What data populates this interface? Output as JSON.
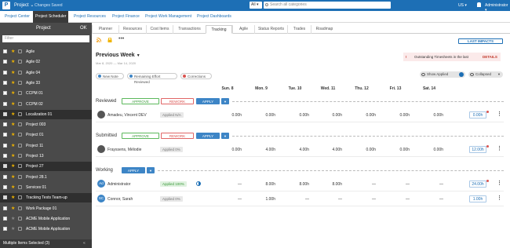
{
  "topbar": {
    "logo": "P",
    "project": "Project",
    "saved": "Changes Saved",
    "scope": "All",
    "search_placeholder": "Search all categories",
    "locale": "US",
    "user": "Administrator"
  },
  "nav": {
    "tabs": [
      "Project Center",
      "Project Scheduler",
      "Project Resources",
      "Project Finance",
      "Project Work Management",
      "Project Dashboards"
    ],
    "active": 1
  },
  "sidebar": {
    "title": "Project",
    "ok": "OK",
    "filter_placeholder": "Filter",
    "items": [
      {
        "label": "Agile",
        "star": true,
        "selected": false
      },
      {
        "label": "Agile 02",
        "star": true,
        "selected": false
      },
      {
        "label": "Agile 04",
        "star": true,
        "selected": false
      },
      {
        "label": "Agile 33",
        "star": true,
        "selected": false
      },
      {
        "label": "CCPM 01",
        "star": true,
        "selected": false
      },
      {
        "label": "CCPM 02",
        "star": true,
        "selected": false
      },
      {
        "label": "Localization 01",
        "star": true,
        "selected": true
      },
      {
        "label": "Project 003",
        "star": true,
        "selected": false
      },
      {
        "label": "Project 01",
        "star": true,
        "selected": false
      },
      {
        "label": "Project 11",
        "star": true,
        "selected": false
      },
      {
        "label": "Project 13",
        "star": true,
        "selected": false
      },
      {
        "label": "Project 27",
        "star": true,
        "selected": true
      },
      {
        "label": "Project 28.1",
        "star": true,
        "selected": false
      },
      {
        "label": "Services 01",
        "star": true,
        "selected": false
      },
      {
        "label": "Tracking Tests Team-up",
        "star": true,
        "selected": true
      },
      {
        "label": "Work Package 01",
        "star": true,
        "selected": false
      },
      {
        "label": "ACME Mobile Application",
        "star": false,
        "selected": false
      },
      {
        "label": "ACME Mobile Application",
        "star": false,
        "selected": false
      }
    ],
    "footer": "Multiple Items Selected (3)",
    "collapse": "«"
  },
  "subtabs": {
    "items": [
      "Planner",
      "Resources",
      "Cost Items",
      "Transactions",
      "Tracking",
      "Agile",
      "Status Reports",
      "Trades",
      "Roadmap"
    ],
    "active": 4
  },
  "toolbar": {
    "last_impacts": "LAST IMPACTS"
  },
  "period": {
    "title": "Previous Week",
    "range": "Mar 8, 2020 — Mar 14, 2020"
  },
  "warning": {
    "icon": "!",
    "text": "Outstanding Timesheets in the last",
    "link": "DETAILS"
  },
  "filters": {
    "new_note": "New Note",
    "remaining": "Remaining Effort Reviewed",
    "corrections": "Corrections",
    "show_applied": "Show Applied",
    "collapsed": "Collapsed"
  },
  "days": [
    "Sun. 8",
    "Mon. 9",
    "Tue. 10",
    "Wed. 11",
    "Thu. 12",
    "Fri. 13",
    "Sat. 14"
  ],
  "actions": {
    "approve": "APPROVE",
    "reword": "REWORK",
    "apply": "APPLY",
    "drop": "▼"
  },
  "sections": [
    {
      "title": "Reviewed",
      "rows": [
        {
          "initials": "",
          "name": "Amadeu, Vincent DEV",
          "status": "Applied",
          "pct": "N/A",
          "cells": [
            "0.00h",
            "0.00h",
            "0.00h",
            "0.00h",
            "0.00h",
            "0.00h",
            "0.00h"
          ],
          "total": "0.00h"
        }
      ]
    },
    {
      "title": "Submitted",
      "rows": [
        {
          "initials": "",
          "name": "Frayssens, Mélodie",
          "status": "Applied",
          "pct": "0%",
          "cells": [
            "0.00h",
            "4.00h",
            "4.00h",
            "4.00h",
            "0.00h",
            "0.00h",
            "0.00h"
          ],
          "total": "12.00h"
        }
      ]
    },
    {
      "title": "Working",
      "rows": [
        {
          "initials": "Ad",
          "name": "Administrator",
          "status": "Applied",
          "pct": "100%",
          "cells": [
            "—",
            "8.00h",
            "8.00h",
            "8.00h",
            "—",
            "—",
            "—"
          ],
          "total": "24.00h"
        },
        {
          "initials": "SC",
          "name": "Connor, Sarah",
          "status": "Applied",
          "pct": "0%",
          "cells": [
            "—",
            "1.00h",
            "—",
            "—",
            "—",
            "—",
            "—"
          ],
          "total": "1.00h"
        }
      ]
    }
  ]
}
